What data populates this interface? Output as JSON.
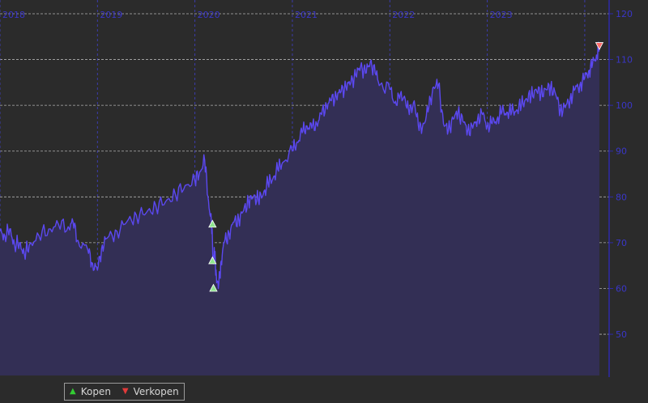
{
  "chart_data": {
    "type": "area",
    "x_tick_labels": [
      "2018",
      "2019",
      "2020",
      "2021",
      "2022",
      "2023"
    ],
    "y_tick_labels": [
      "50",
      "60",
      "70",
      "80",
      "90",
      "100",
      "110",
      "120"
    ],
    "ylim": [
      41,
      123
    ],
    "xlim": [
      2018.0,
      2024.25
    ],
    "grid": true,
    "x_years": [
      2018.0,
      2018.05,
      2018.1,
      2018.15,
      2018.2,
      2018.25,
      2018.3,
      2018.4,
      2018.5,
      2018.6,
      2018.7,
      2018.75,
      2018.8,
      2018.9,
      2018.95,
      2019.0,
      2019.05,
      2019.1,
      2019.2,
      2019.3,
      2019.4,
      2019.5,
      2019.6,
      2019.7,
      2019.8,
      2019.9,
      2020.0,
      2020.05,
      2020.1,
      2020.14,
      2020.17,
      2020.19,
      2020.2,
      2020.22,
      2020.24,
      2020.27,
      2020.3,
      2020.35,
      2020.4,
      2020.45,
      2020.5,
      2020.55,
      2020.6,
      2020.65,
      2020.7,
      2020.75,
      2020.8,
      2020.85,
      2020.9,
      2021.0,
      2021.05,
      2021.1,
      2021.15,
      2021.2,
      2021.25,
      2021.3,
      2021.35,
      2021.4,
      2021.45,
      2021.5,
      2021.55,
      2021.6,
      2021.65,
      2021.7,
      2021.75,
      2021.8,
      2021.85,
      2021.9,
      2022.0,
      2022.05,
      2022.1,
      2022.15,
      2022.2,
      2022.25,
      2022.3,
      2022.35,
      2022.4,
      2022.45,
      2022.5,
      2022.55,
      2022.6,
      2022.65,
      2022.7,
      2022.75,
      2022.8,
      2022.85,
      2022.9,
      2022.95,
      2023.0,
      2023.05,
      2023.1,
      2023.15,
      2023.2,
      2023.25,
      2023.3,
      2023.35,
      2023.4,
      2023.45,
      2023.5,
      2023.55,
      2023.6,
      2023.65,
      2023.7,
      2023.75,
      2023.8,
      2023.85,
      2023.9,
      2023.95,
      2024.0,
      2024.04,
      2024.08,
      2024.12,
      2024.15
    ],
    "series": [
      {
        "values": [
          72.5,
          71.5,
          73.0,
          69.5,
          70.0,
          67.5,
          69.5,
          71.5,
          73.0,
          74.0,
          73.5,
          74.5,
          70.5,
          68.5,
          65.5,
          64.0,
          69.5,
          71.0,
          72.5,
          74.5,
          76.0,
          76.5,
          78.0,
          79.0,
          80.5,
          82.5,
          83.5,
          85.5,
          88.0,
          79.0,
          74.0,
          66.0,
          68.0,
          63.0,
          60.0,
          66.0,
          70.0,
          72.0,
          74.5,
          75.0,
          77.0,
          79.0,
          80.0,
          79.5,
          80.5,
          83.0,
          84.0,
          86.0,
          87.5,
          90.0,
          92.0,
          94.0,
          95.5,
          95.0,
          96.0,
          98.0,
          100.0,
          101.0,
          102.0,
          103.0,
          104.0,
          105.0,
          106.5,
          108.5,
          107.0,
          109.5,
          107.0,
          104.5,
          103.5,
          100.5,
          101.5,
          102.0,
          98.0,
          101.0,
          94.5,
          96.0,
          99.5,
          104.0,
          104.5,
          96.0,
          94.5,
          97.0,
          98.5,
          96.5,
          94.5,
          95.0,
          97.0,
          98.0,
          95.5,
          96.0,
          97.0,
          98.5,
          98.5,
          98.5,
          99.0,
          100.0,
          101.5,
          102.0,
          103.5,
          102.5,
          103.5,
          104.0,
          102.5,
          99.0,
          99.5,
          101.5,
          103.5,
          104.5,
          106.0,
          107.5,
          109.0,
          111.0,
          113.0
        ]
      }
    ],
    "markers": [
      {
        "type": "buy",
        "x": 2020.18,
        "y": 74.0
      },
      {
        "type": "buy",
        "x": 2020.18,
        "y": 66.0
      },
      {
        "type": "buy",
        "x": 2020.19,
        "y": 60.0
      },
      {
        "type": "sell",
        "x": 2024.15,
        "y": 113.0
      }
    ],
    "legend": [
      {
        "symbol": "▲",
        "label": "Kopen",
        "color": "#33cc33"
      },
      {
        "symbol": "▼",
        "label": "Verkopen",
        "color": "#e23a3a"
      }
    ],
    "colors": {
      "line": "#5b48f0",
      "fill": "#332f55",
      "background": "#2b2b2b",
      "axis": "#2e2aa8",
      "tick_label": "#3a36c8",
      "grid_h": "#c8c8c8",
      "grid_v": "#4040c8"
    }
  }
}
